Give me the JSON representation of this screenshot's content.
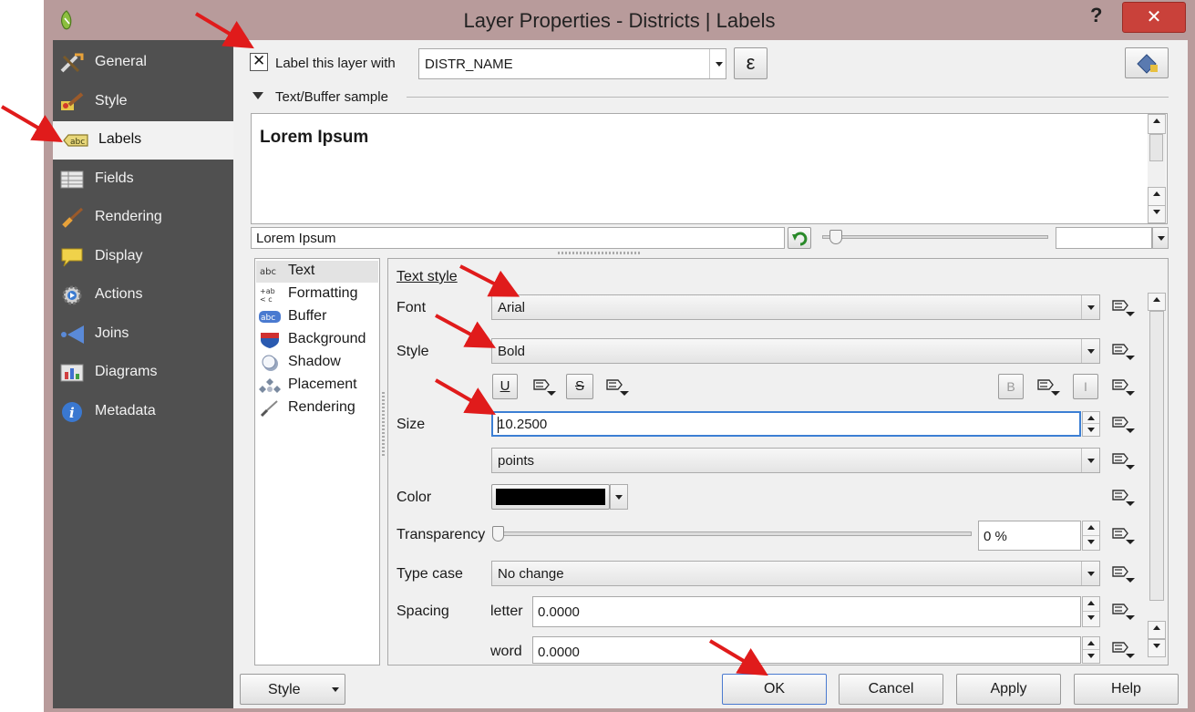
{
  "window": {
    "title": "Layer Properties - Districts | Labels",
    "help_glyph": "?",
    "close_glyph": "✕"
  },
  "sidebar": {
    "items": [
      {
        "label": "General",
        "icon": "general-tools-icon"
      },
      {
        "label": "Style",
        "icon": "style-brush-icon"
      },
      {
        "label": "Labels",
        "icon": "abc-labels-icon"
      },
      {
        "label": "Fields",
        "icon": "fields-table-icon"
      },
      {
        "label": "Rendering",
        "icon": "rendering-brush-icon"
      },
      {
        "label": "Display",
        "icon": "display-bubble-icon"
      },
      {
        "label": "Actions",
        "icon": "actions-gear-icon"
      },
      {
        "label": "Joins",
        "icon": "joins-arrow-icon"
      },
      {
        "label": "Diagrams",
        "icon": "diagrams-chart-icon"
      },
      {
        "label": "Metadata",
        "icon": "metadata-info-icon"
      }
    ],
    "selected": "Labels"
  },
  "labels": {
    "checkbox_mark": "✕",
    "checkbox_label": "Label this layer with",
    "field_value": "DISTR_NAME",
    "expression_glyph": "ε"
  },
  "sample": {
    "section_title": "Text/Buffer sample",
    "preview_text": "Lorem Ipsum",
    "input_value": "Lorem Ipsum"
  },
  "tree": {
    "items": [
      {
        "label": "Text",
        "icon": "abc-text-icon"
      },
      {
        "label": "Formatting",
        "icon": "formatting-icon"
      },
      {
        "label": "Buffer",
        "icon": "abc-buffer-icon"
      },
      {
        "label": "Background",
        "icon": "background-shield-icon"
      },
      {
        "label": "Shadow",
        "icon": "shadow-icon"
      },
      {
        "label": "Placement",
        "icon": "placement-icon"
      },
      {
        "label": "Rendering",
        "icon": "rendering-icon"
      }
    ]
  },
  "text_style": {
    "heading": "Text style",
    "font_label": "Font",
    "font_value": "Arial",
    "style_label": "Style",
    "style_value": "Bold",
    "underline_glyph": "U",
    "strike_glyph": "S",
    "bold_glyph": "B",
    "italic_glyph": "I",
    "size_label": "Size",
    "size_value": "10.2500",
    "unit_value": "points",
    "color_label": "Color",
    "color_hex": "#000000",
    "transparency_label": "Transparency",
    "transparency_value": "0 %",
    "transparency_fraction": 0,
    "typecase_label": "Type case",
    "typecase_value": "No change",
    "spacing_label": "Spacing",
    "letter_label": "letter",
    "letter_value": "0.0000",
    "word_label": "word",
    "word_value": "0.0000"
  },
  "footer": {
    "style_button": "Style",
    "ok": "OK",
    "cancel": "Cancel",
    "apply": "Apply",
    "help": "Help"
  },
  "colors": {
    "title_bar": "#b89b9b",
    "sidebar": "#505050",
    "close": "#c9413a",
    "annotation_arrow": "#e01b1b",
    "focus": "#3c7fd4"
  }
}
